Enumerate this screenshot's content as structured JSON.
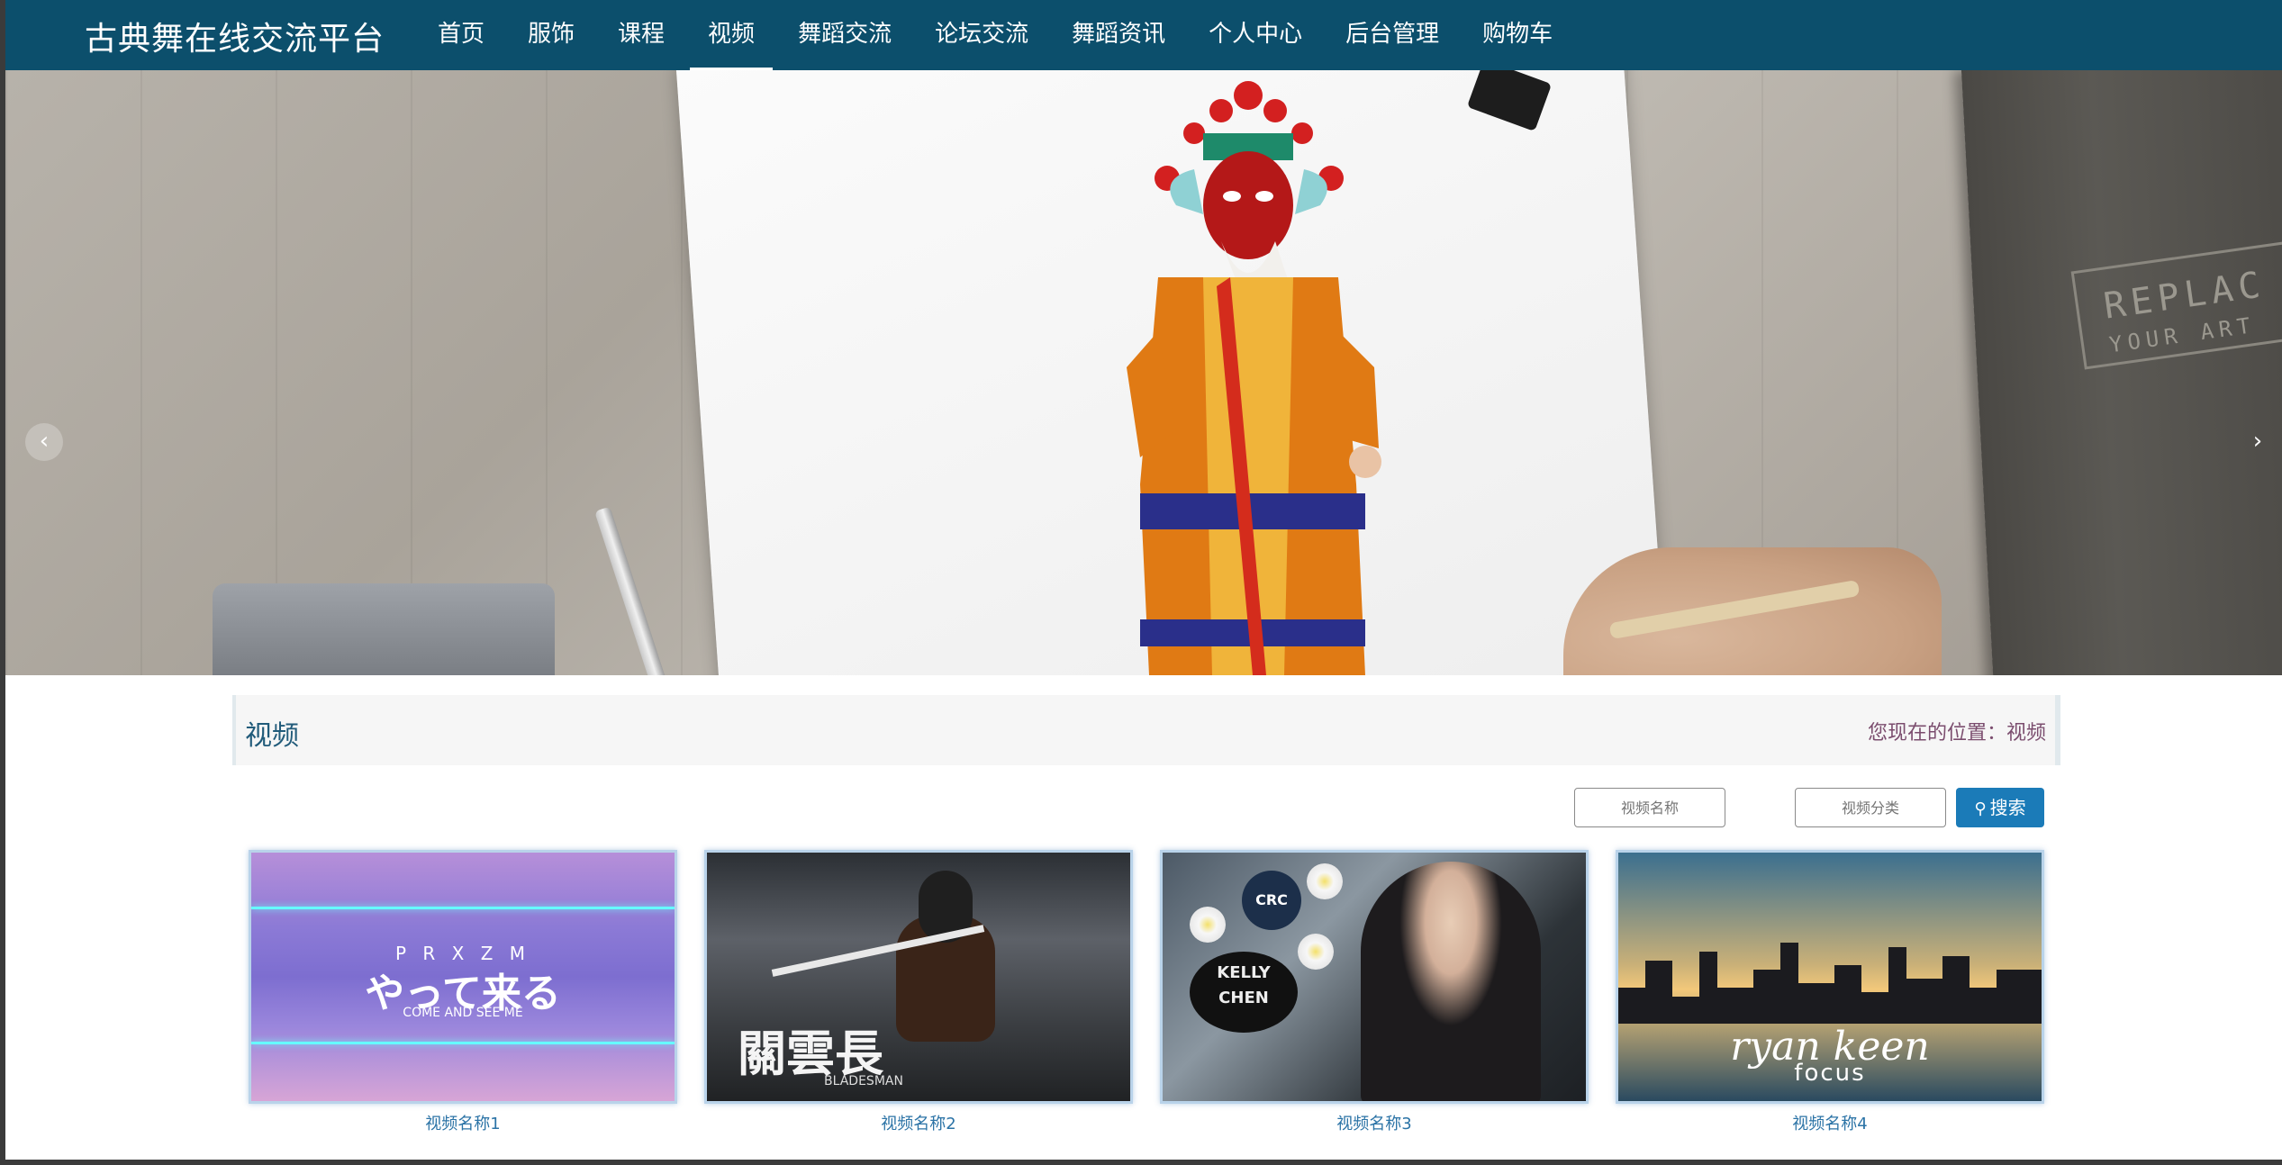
{
  "brand": "古典舞在线交流平台",
  "nav": {
    "items": [
      "首页",
      "服饰",
      "课程",
      "视频",
      "舞蹈交流",
      "论坛交流",
      "舞蹈资讯",
      "个人中心",
      "后台管理",
      "购物车"
    ],
    "active_index": 3
  },
  "hero": {
    "book_text": "REPLAC",
    "book_subtext": "YOUR ART",
    "slide_count": 3,
    "active_slide": 0
  },
  "section": {
    "title": "视频",
    "location_label": "您现在的位置：视频"
  },
  "search": {
    "name_placeholder": "视频名称",
    "category_placeholder": "视频分类",
    "button_label": "搜索"
  },
  "videos": [
    {
      "name": "视频名称1",
      "thumb_line1": "P R X Z M",
      "thumb_line2": "やって来る",
      "thumb_line3": "COME AND SEE ME"
    },
    {
      "name": "视频名称2",
      "thumb_text": "關雲長",
      "thumb_sub": "BLADESMAN"
    },
    {
      "name": "视频名称3",
      "badge": "CRC",
      "logo_text": "KELLY CHEN"
    },
    {
      "name": "视频名称4",
      "thumb_line1": "ryan keen",
      "thumb_line2": "focus"
    }
  ],
  "colors": {
    "nav_bg": "#0c4f6c",
    "accent": "#1b7bb8",
    "caption": "#2b73a6"
  }
}
